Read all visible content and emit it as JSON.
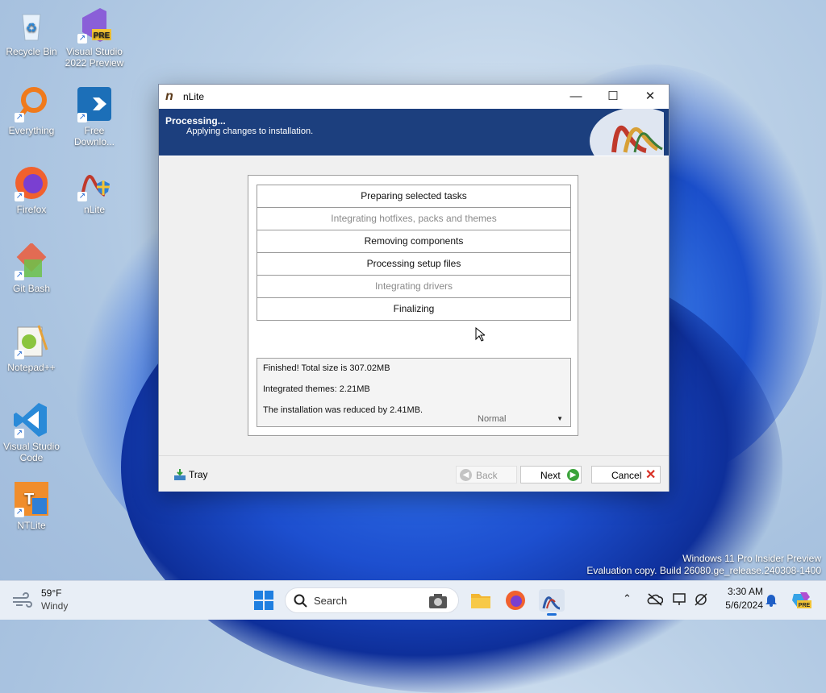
{
  "desktop": {
    "icons": [
      {
        "label": "Recycle Bin"
      },
      {
        "label": "Visual Studio 2022 Preview",
        "badge": "PRE"
      },
      {
        "label": "Everything"
      },
      {
        "label": "Free Downlo..."
      },
      {
        "label": "Firefox"
      },
      {
        "label": "nLite"
      },
      {
        "label": "Git Bash"
      },
      {
        "label": "Notepad++"
      },
      {
        "label": "Visual Studio Code"
      },
      {
        "label": "NTLite"
      }
    ],
    "watermark": {
      "line1": "Windows 11 Pro Insider Preview",
      "line2": "Evaluation copy. Build 26080.ge_release.240308-1400"
    }
  },
  "window": {
    "title": "nLite",
    "controls": {
      "minimize": "—",
      "maximize": "☐",
      "close": "✕"
    },
    "banner": {
      "heading": "Processing...",
      "subheading": "Applying changes to installation."
    },
    "steps": [
      {
        "label": "Preparing selected tasks",
        "state": "done"
      },
      {
        "label": "Integrating hotfixes, packs and themes",
        "state": "skipped"
      },
      {
        "label": "Removing components",
        "state": "done"
      },
      {
        "label": "Processing setup files",
        "state": "done"
      },
      {
        "label": "Integrating drivers",
        "state": "skipped"
      },
      {
        "label": "Finalizing",
        "state": "done"
      }
    ],
    "summary": {
      "line1": "Finished! Total size is 307.02MB",
      "line2": "Integrated themes: 2.21MB",
      "line3": "The installation was reduced by 2.41MB.",
      "priority_select": "Normal"
    },
    "footer": {
      "tray": "Tray",
      "back": "Back",
      "next": "Next",
      "cancel": "Cancel"
    }
  },
  "taskbar": {
    "weather": {
      "temp": "59°F",
      "condition": "Windy"
    },
    "search_placeholder": "Search",
    "clock": {
      "time": "3:30 AM",
      "date": "5/6/2024"
    },
    "copilot_badge": "PRE"
  },
  "colors": {
    "banner": "#1c3f7e",
    "next_icon": "#3aa33a",
    "cancel_icon": "#d93025"
  }
}
